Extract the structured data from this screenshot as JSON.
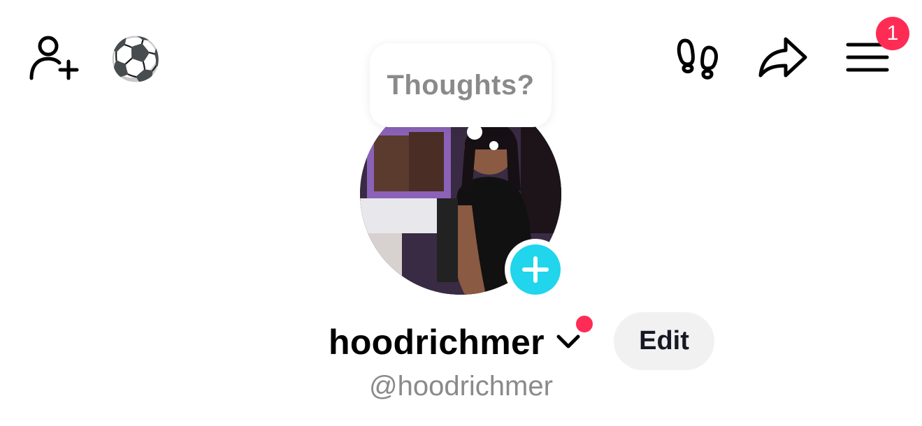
{
  "header": {
    "icons": [
      "add-user-icon",
      "soccer-ball-icon",
      "footprints-icon",
      "share-icon",
      "menu-icon"
    ],
    "menu_badge": "1",
    "soccer_glyph": "⚽"
  },
  "profile": {
    "note_prompt": "Thoughts?",
    "username": "hoodrichmer",
    "handle": "@hoodrichmer",
    "edit_label": "Edit"
  },
  "colors": {
    "accent_red": "#fe2c55",
    "story_add_cyan": "#20d5ec",
    "muted_text": "#8a8a8a",
    "button_bg": "#f1f1f2"
  }
}
